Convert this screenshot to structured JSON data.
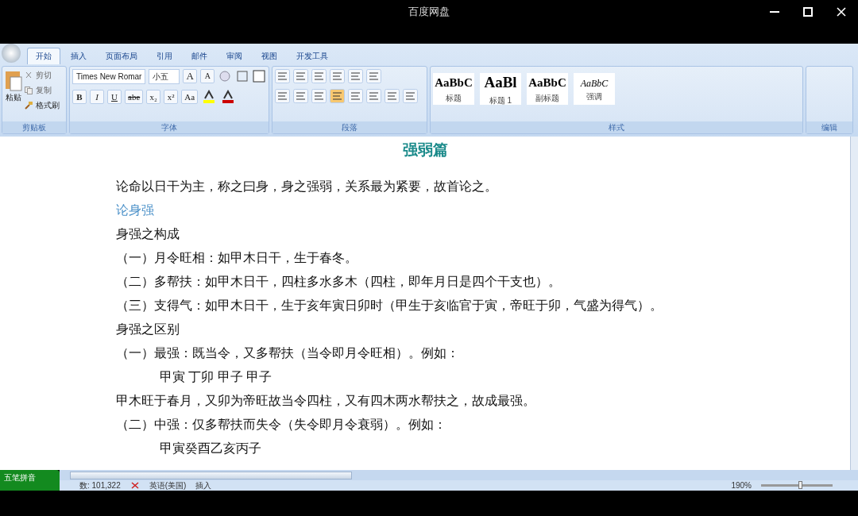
{
  "player": {
    "title": "百度网盘"
  },
  "ribbon": {
    "tabs": [
      {
        "label": "开始",
        "selected": true
      },
      {
        "label": "插入",
        "selected": false
      },
      {
        "label": "页面布局",
        "selected": false
      },
      {
        "label": "引用",
        "selected": false
      },
      {
        "label": "邮件",
        "selected": false
      },
      {
        "label": "审阅",
        "selected": false
      },
      {
        "label": "视图",
        "selected": false
      },
      {
        "label": "开发工具",
        "selected": false
      }
    ],
    "clipboard": {
      "paste": "粘贴",
      "cut": "剪切",
      "copy": "复制",
      "format_painter": "格式刷",
      "label": "剪贴板"
    },
    "font": {
      "name": "Times New Romar",
      "size": "小五",
      "size_buttons": [
        "A",
        "A"
      ],
      "format_buttons": [
        "B",
        "I",
        "U",
        "abe",
        "x₂",
        "x²",
        "Aa"
      ],
      "label": "字体"
    },
    "paragraph": {
      "label": "段落"
    },
    "styles": {
      "items": [
        {
          "preview": "AaBbC",
          "label": "标题"
        },
        {
          "preview": "AaBl",
          "label": "标题 1"
        },
        {
          "preview": "AaBbC",
          "label": "副标题"
        },
        {
          "preview": "AaBbC",
          "label": "强调"
        }
      ],
      "label": "样式"
    },
    "editing": {
      "label": "编辑"
    }
  },
  "document": {
    "title": "强弱篇",
    "paragraphs": [
      {
        "kind": "body",
        "text": "论命以日干为主，称之曰身，身之强弱，关系最为紧要，故首论之。"
      },
      {
        "kind": "heading",
        "text": "论身强"
      },
      {
        "kind": "body",
        "text": "身强之构成"
      },
      {
        "kind": "item",
        "text": "（一）月令旺相：如甲木日干，生于春冬。"
      },
      {
        "kind": "item",
        "text": "（二）多帮扶：如甲木日干，四柱多水多木（四柱，即年月日是四个干支也）。"
      },
      {
        "kind": "item",
        "text": "（三）支得气：如甲木日干，生于亥年寅日卯时（甲生于亥临官于寅，帝旺于卯，气盛为得气）。"
      },
      {
        "kind": "body",
        "text": "身强之区别"
      },
      {
        "kind": "item",
        "text": "（一）最强：既当令，又多帮扶（当令即月令旺相）。例如："
      },
      {
        "kind": "example",
        "text": "甲寅  丁卯  甲子  甲子"
      },
      {
        "kind": "body",
        "text": "甲木旺于春月，又卯为帝旺故当令四柱，又有四木两水帮扶之，故成最强。"
      },
      {
        "kind": "item",
        "text": "（二）中强：仅多帮扶而失令（失令即月令衰弱）。例如："
      },
      {
        "kind": "example",
        "text": "甲寅癸酉乙亥丙子"
      }
    ]
  },
  "ime": {
    "label": "五笔拼音"
  },
  "status_bar": {
    "word_count": "数: 101,322",
    "language": "英语(美国)",
    "mode": "插入",
    "zoom": "190%",
    "zoom_slider": {
      "level": 0.55
    }
  }
}
